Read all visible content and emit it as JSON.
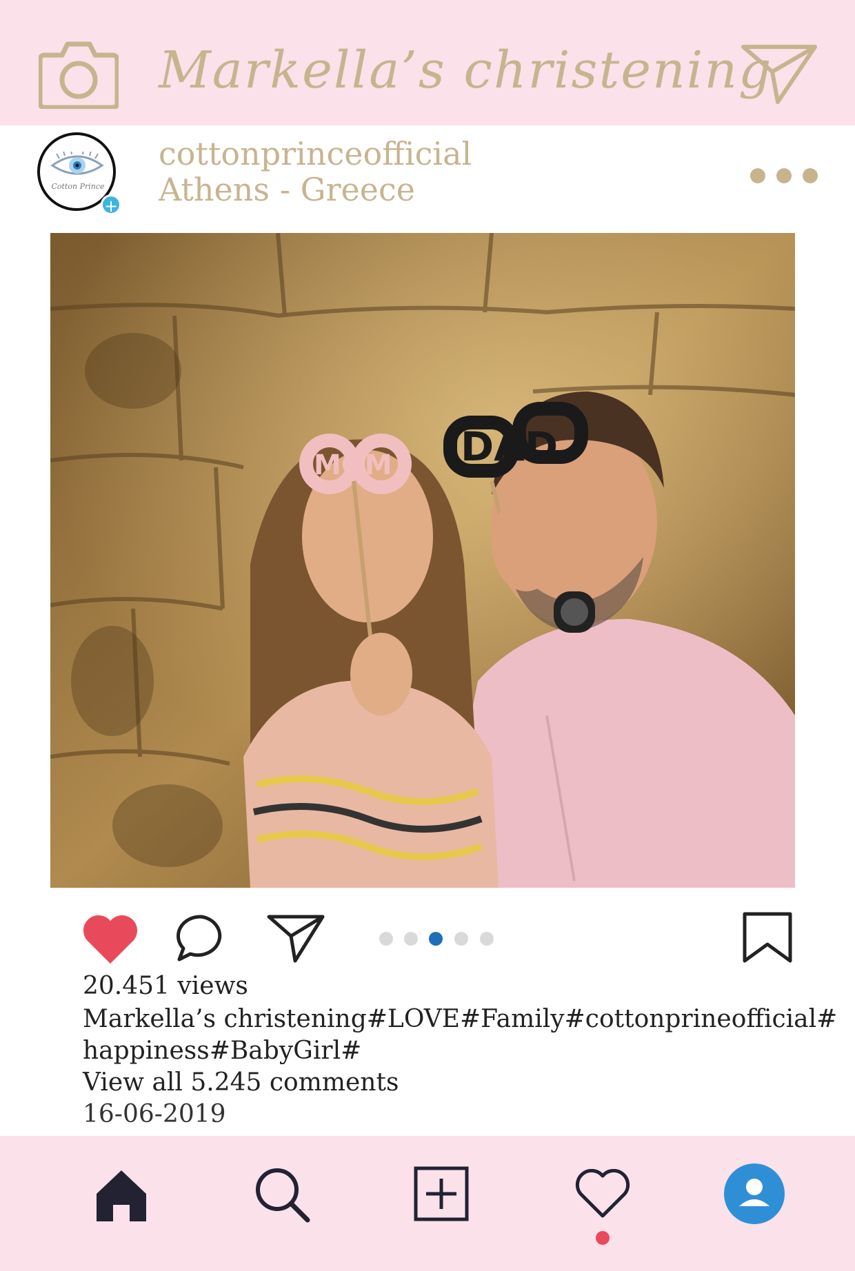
{
  "header": {
    "title": "Markella’s christening",
    "camera_icon": "camera-icon",
    "send_icon": "paper-plane-icon",
    "accent_color": "#c7b48f",
    "background_color": "#fae1ea"
  },
  "profile": {
    "username": "cottonprinceofficial",
    "location": "Athens - Greece",
    "avatar_brand": "Cotton Prince",
    "avatar_icon": "evil-eye-logo",
    "plus_icon": "plus-icon",
    "more_icon": "more-dots-icon"
  },
  "post": {
    "photo_description_icon": "photo",
    "carousel": {
      "count": 5,
      "active_index": 2,
      "active_color": "#1e6fb8"
    },
    "liked": true,
    "like_color": "#e94a5b"
  },
  "stats": {
    "views": "20.451 views",
    "caption_line1": "Markella’s christening#LOVE#Family#cottonprineofficial#",
    "caption_line2": "happiness#BabyGirl#",
    "comments_link": "View all 5.245 comments",
    "date": "16-06-2019"
  },
  "nav": {
    "items": [
      "home-icon",
      "search-icon",
      "add-post-icon",
      "heart-icon",
      "profile-icon"
    ],
    "profile_color": "#2f8fd6"
  }
}
